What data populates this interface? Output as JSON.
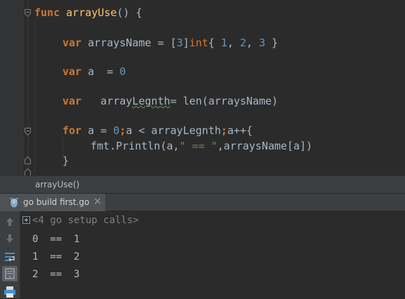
{
  "editor": {
    "lines": {
      "l1": {
        "kw": "func",
        "name": "arrayUse",
        "rest": "() {"
      },
      "l2": {
        "kw": "var",
        "name": "arraysName = [",
        "n3": "3",
        "close": "]",
        "type": "int",
        "open": "{ ",
        "a": "1",
        "c1": ", ",
        "b": "2",
        "c2": ", ",
        "c": "3",
        "end": " }"
      },
      "l3": {
        "kw": "var",
        "text": "a  = ",
        "n0": "0"
      },
      "l4": {
        "kw": "var",
        "pre": "  array",
        "typo": "Legnth",
        "rest": "= len(arraysName)"
      },
      "l5": {
        "kw": "for",
        "a": "a = ",
        "n0": "0",
        "semi1": ";",
        "b": "a < arrayLegnth",
        "semi2": ";",
        "c": "a++{"
      },
      "l6": {
        "a": "fmt.Println(a,",
        "s": "\" == \"",
        "b": ",arraysName[a])"
      },
      "l7": {
        "text": "}"
      }
    }
  },
  "breadcrumb": {
    "label": "arrayUse()"
  },
  "run_tab": {
    "label": "go build first.go",
    "close": "×"
  },
  "console": {
    "setup_calls": "<4 go setup calls>",
    "output": [
      "0  ==  1",
      "1  ==  2",
      "2  ==  3"
    ]
  },
  "colors": {
    "keyword": "#cc7832",
    "function": "#ffc66d",
    "number": "#6897bb",
    "string": "#6a8759",
    "text": "#a9b7c6",
    "background": "#2b2b2b"
  },
  "icons": [
    "fold-marker-icon",
    "go-gopher-icon",
    "close-icon",
    "up-arrow-icon",
    "down-arrow-icon",
    "soft-wrap-icon",
    "scroll-to-end-icon",
    "print-icon",
    "expand-plus-icon"
  ]
}
